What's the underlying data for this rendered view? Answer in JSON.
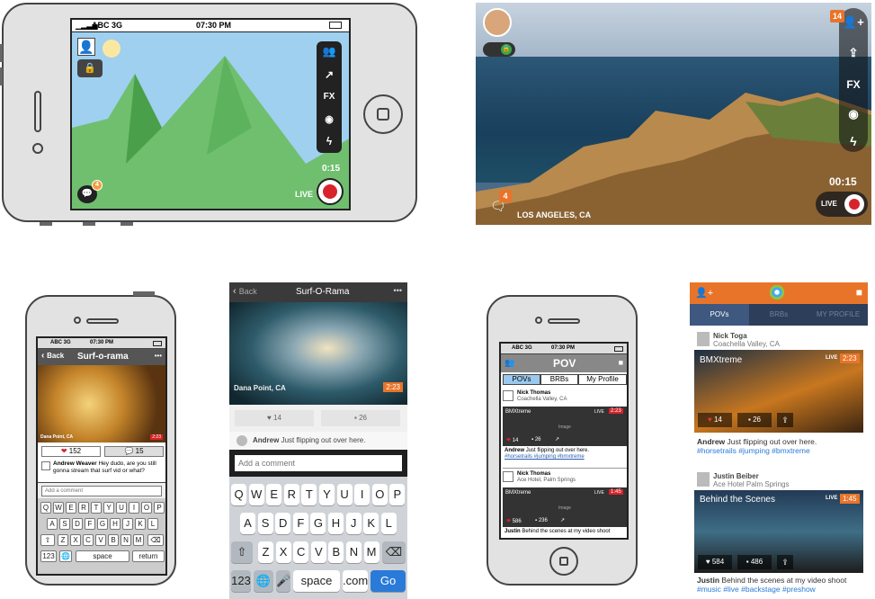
{
  "wf1": {
    "carrier": "ABC 3G",
    "time": "07:30 PM",
    "timer": "0:15",
    "live": "LIVE",
    "fx": "FX",
    "badge": "4"
  },
  "photo1": {
    "badge": "14",
    "fx": "FX",
    "timer": "00:15",
    "live": "LIVE",
    "chat_badge": "4",
    "location": "LOS ANGELES, CA"
  },
  "wf2": {
    "carrier": "ABC 3G",
    "time": "07:30 PM",
    "back": "Back",
    "title": "Surf-o-rama",
    "more": "•••",
    "video_label": "Dana Point, CA",
    "video_time": "2:23",
    "likes": "152",
    "comments": "15",
    "comment_user": "Andrew Weaver",
    "comment_text": "Hey dudo, are you still gonna stream that surf vid or what?",
    "input_placeholder": "Add a comment",
    "row1": [
      "Q",
      "W",
      "E",
      "R",
      "T",
      "Y",
      "U",
      "I",
      "O",
      "P"
    ],
    "row2": [
      "A",
      "S",
      "D",
      "F",
      "G",
      "H",
      "J",
      "K",
      "L"
    ],
    "row3": [
      "Z",
      "X",
      "C",
      "V",
      "B",
      "N",
      "M"
    ],
    "k123": "123",
    "space": "space",
    "return": "return"
  },
  "mock2": {
    "back": "Back",
    "title": "Surf-O-Rama",
    "more": "•••",
    "video_label": "Dana Point, CA",
    "video_time": "2:23",
    "likes": "14",
    "comments": "26",
    "comment_user": "Andrew",
    "comment_text": "Just flipping out over here.",
    "input_placeholder": "Add a comment",
    "row1": [
      "Q",
      "W",
      "E",
      "R",
      "T",
      "Y",
      "U",
      "I",
      "O",
      "P"
    ],
    "row2": [
      "A",
      "S",
      "D",
      "F",
      "G",
      "H",
      "J",
      "K",
      "L"
    ],
    "row3": [
      "Z",
      "X",
      "C",
      "V",
      "B",
      "N",
      "M"
    ],
    "k123": "123",
    "space": "space",
    "com": ".com",
    "go": "Go"
  },
  "wf3": {
    "carrier": "ABC 3G",
    "time": "07:30 PM",
    "title": "POV",
    "tabs": [
      "POVs",
      "BRBs",
      "My Profile"
    ],
    "p1_name": "Nick Thomas",
    "p1_loc": "Coachella Valley, CA",
    "p1_title": "BMXtreme",
    "p1_live": "LIVE",
    "p1_time": "2:23",
    "p1_image": "Image",
    "p1_likes": "14",
    "p1_comments": "26",
    "p1_cuser": "Andrew",
    "p1_ctext": "Just flipping out over here.",
    "p1_tags": "#horsetrails #jumping #bmxtreme",
    "p2_name": "Nick Thomas",
    "p2_loc": "Ace Hotel, Palm Springs",
    "p2_title": "BMXtreme",
    "p2_live": "LIVE",
    "p2_time": "1:45",
    "p2_image": "Image",
    "p2_likes": "586",
    "p2_comments": "236",
    "p2_cuser": "Justin",
    "p2_ctext": "Behind the scenes at my video shoot"
  },
  "mock3": {
    "tabs": [
      "POVs",
      "BRBs",
      "MY PROFILE"
    ],
    "p1_name": "Nick Toga",
    "p1_loc": "Coachella Valley, CA",
    "p1_title": "BMXtreme",
    "p1_live": "LIVE",
    "p1_time": "2:23",
    "p1_likes": "14",
    "p1_comments": "26",
    "p1_cuser": "Andrew",
    "p1_ctext": "Just flipping out over here.",
    "p1_tags": "#horsetrails #jumping #bmxtreme",
    "p2_name": "Justin Beiber",
    "p2_loc": "Ace Hotel Palm Springs",
    "p2_title": "Behind the Scenes",
    "p2_live": "LIVE",
    "p2_time": "1:45",
    "p2_likes": "584",
    "p2_comments": "486",
    "p2_cuser": "Justin",
    "p2_ctext": "Behind the scenes at my video shoot",
    "p2_tags": "#music #live #backstage #preshow"
  }
}
